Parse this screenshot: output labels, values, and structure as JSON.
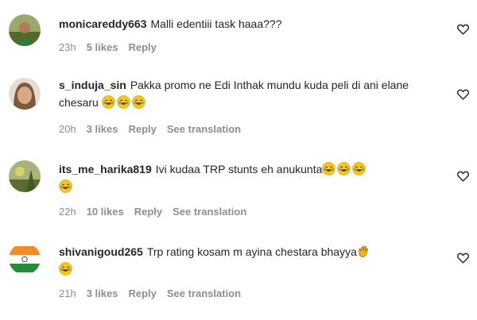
{
  "comments": [
    {
      "username": "monicareddy663",
      "text": "Malli edentiii task haaa???",
      "emojis": [],
      "emojis_line2": [],
      "time": "23h",
      "likes": "5 likes",
      "reply": "Reply",
      "translation": "",
      "avatar_icon": "avatar-woman-green"
    },
    {
      "username": "s_induja_sin",
      "text": "Pakka promo ne Edi Inthak mundu kuda peli di ani elane chesaru",
      "emojis": [
        "laughing-emoji",
        "laughing-emoji",
        "laughing-emoji"
      ],
      "emojis_line2": [],
      "time": "20h",
      "likes": "3 likes",
      "reply": "Reply",
      "translation": "See translation",
      "avatar_icon": "avatar-woman-portrait"
    },
    {
      "username": "its_me_harika819",
      "text": "Ivi kudaa TRP stunts eh anukunta",
      "emojis": [
        "laughing-emoji",
        "laughing-emoji",
        "laughing-emoji"
      ],
      "emojis_line2": [
        "laughing-emoji"
      ],
      "time": "22h",
      "likes": "10 likes",
      "reply": "Reply",
      "translation": "See translation",
      "avatar_icon": "avatar-nature"
    },
    {
      "username": "shivanigoud265",
      "text": "Trp rating kosam m ayina chestara bhayya",
      "emojis": [
        "clap-emoji"
      ],
      "emojis_line2": [
        "laughing-emoji"
      ],
      "time": "21h",
      "likes": "3 likes",
      "reply": "Reply",
      "translation": "See translation",
      "avatar_icon": "avatar-india-flag"
    }
  ],
  "colors": {
    "text": "#262626",
    "meta": "#8e8e8e",
    "emoji": "#f5c518"
  }
}
